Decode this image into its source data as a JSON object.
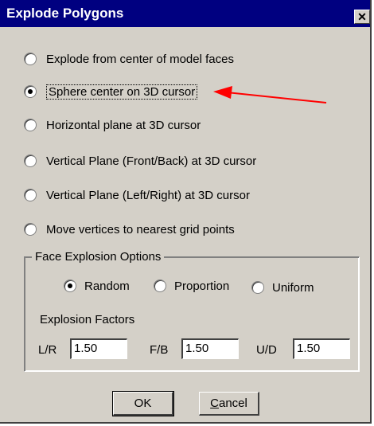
{
  "dialog": {
    "title": "Explode Polygons",
    "close_label": "✕"
  },
  "options": [
    {
      "label": "Explode from center of model faces",
      "checked": false
    },
    {
      "label": "Sphere center on 3D cursor",
      "checked": true
    },
    {
      "label": "Horizontal plane at 3D cursor",
      "checked": false
    },
    {
      "label": "Vertical Plane (Front/Back) at 3D cursor",
      "checked": false
    },
    {
      "label": "Vertical Plane (Left/Right) at 3D cursor",
      "checked": false
    },
    {
      "label": "Move vertices to nearest grid points",
      "checked": false
    }
  ],
  "face_options": {
    "legend": "Face Explosion Options",
    "modes": [
      {
        "label": "Random",
        "checked": true
      },
      {
        "label": "Proportion",
        "checked": false
      },
      {
        "label": "Uniform",
        "checked": false
      }
    ],
    "factors_label": "Explosion Factors",
    "factors": [
      {
        "label": "L/R",
        "value": "1.50"
      },
      {
        "label": "F/B",
        "value": "1.50"
      },
      {
        "label": "U/D",
        "value": "1.50"
      }
    ]
  },
  "buttons": {
    "ok": "OK",
    "cancel_first": "C",
    "cancel_rest": "ancel"
  },
  "colors": {
    "titlebar": "#000080",
    "dialog_bg": "#d4d0c8",
    "annotation_arrow": "#ff0000"
  }
}
